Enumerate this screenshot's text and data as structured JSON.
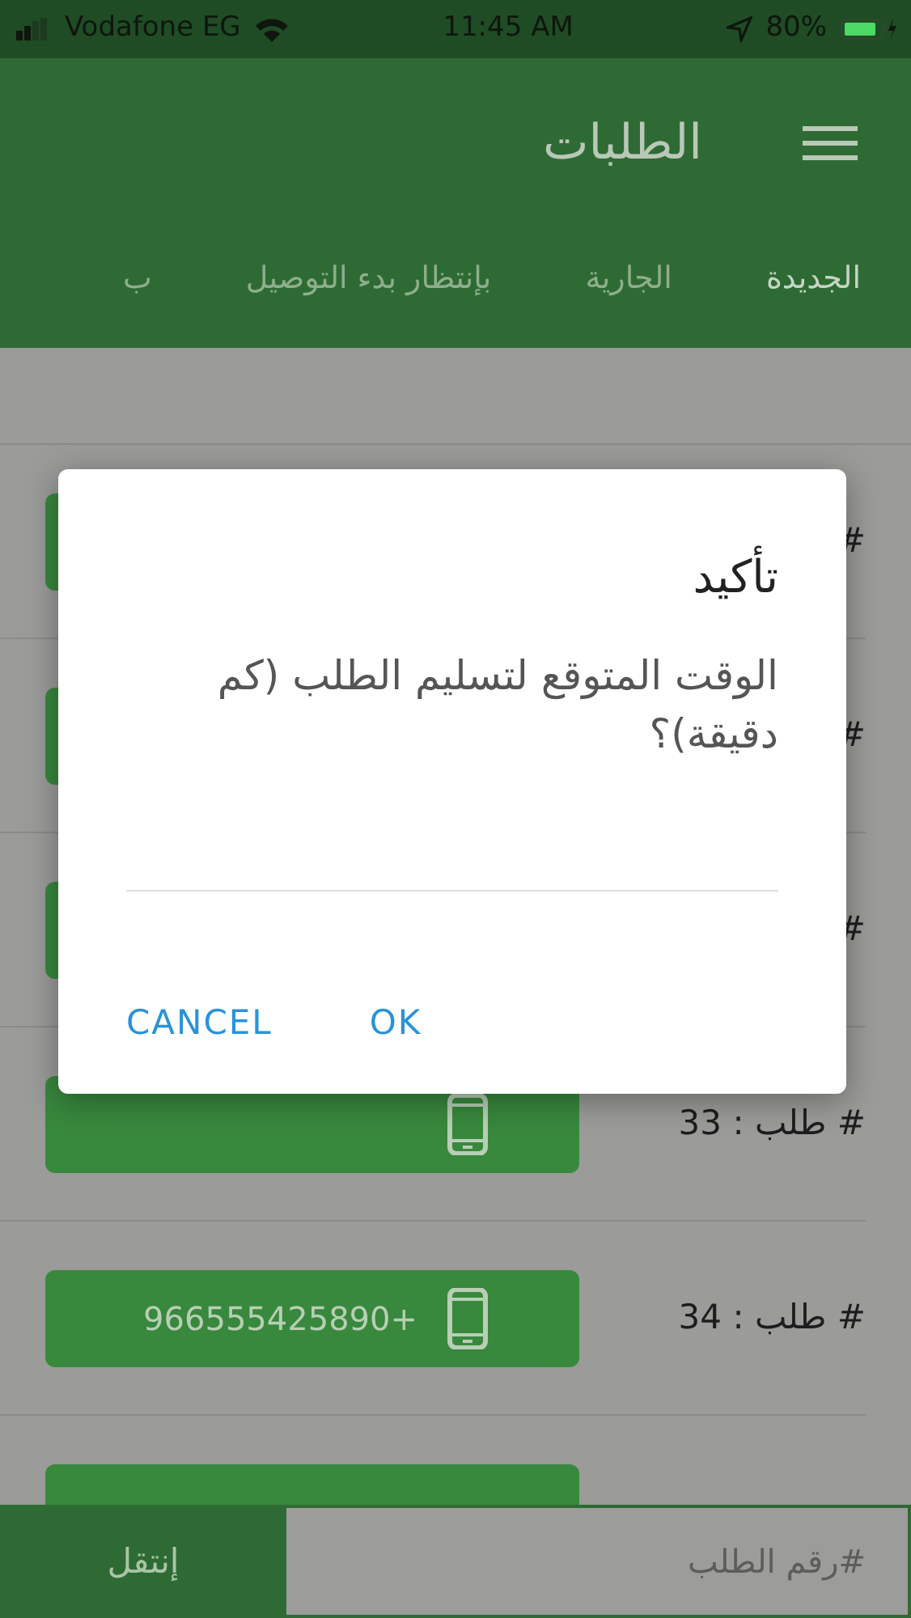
{
  "status_bar": {
    "carrier": "Vodafone EG",
    "time": "11:45 AM",
    "battery": "80%"
  },
  "header": {
    "title": "الطلبات"
  },
  "tabs": [
    {
      "label": "الجديدة",
      "selected": true
    },
    {
      "label": "الجارية",
      "selected": false
    },
    {
      "label": "بإنتظار بدء التوصيل",
      "selected": false
    },
    {
      "label": "ب",
      "selected": false
    }
  ],
  "orders": [
    {
      "kind": "covered",
      "label": "#"
    },
    {
      "kind": "covered",
      "label": "#"
    },
    {
      "kind": "covered",
      "label": "#"
    },
    {
      "kind": "order",
      "label": "# طلب : 33"
    },
    {
      "kind": "order",
      "label": "# طلب : 34",
      "phone": "966555425890+"
    }
  ],
  "dialog": {
    "title": "تأكيد",
    "message": "الوقت المتوقع لتسليم الطلب (كم دقيقة)؟",
    "buttons": [
      "OK",
      "CANCEL"
    ]
  },
  "bottom_bar": {
    "placeholder": "#رقم الطلب",
    "button": "إنتقل"
  }
}
